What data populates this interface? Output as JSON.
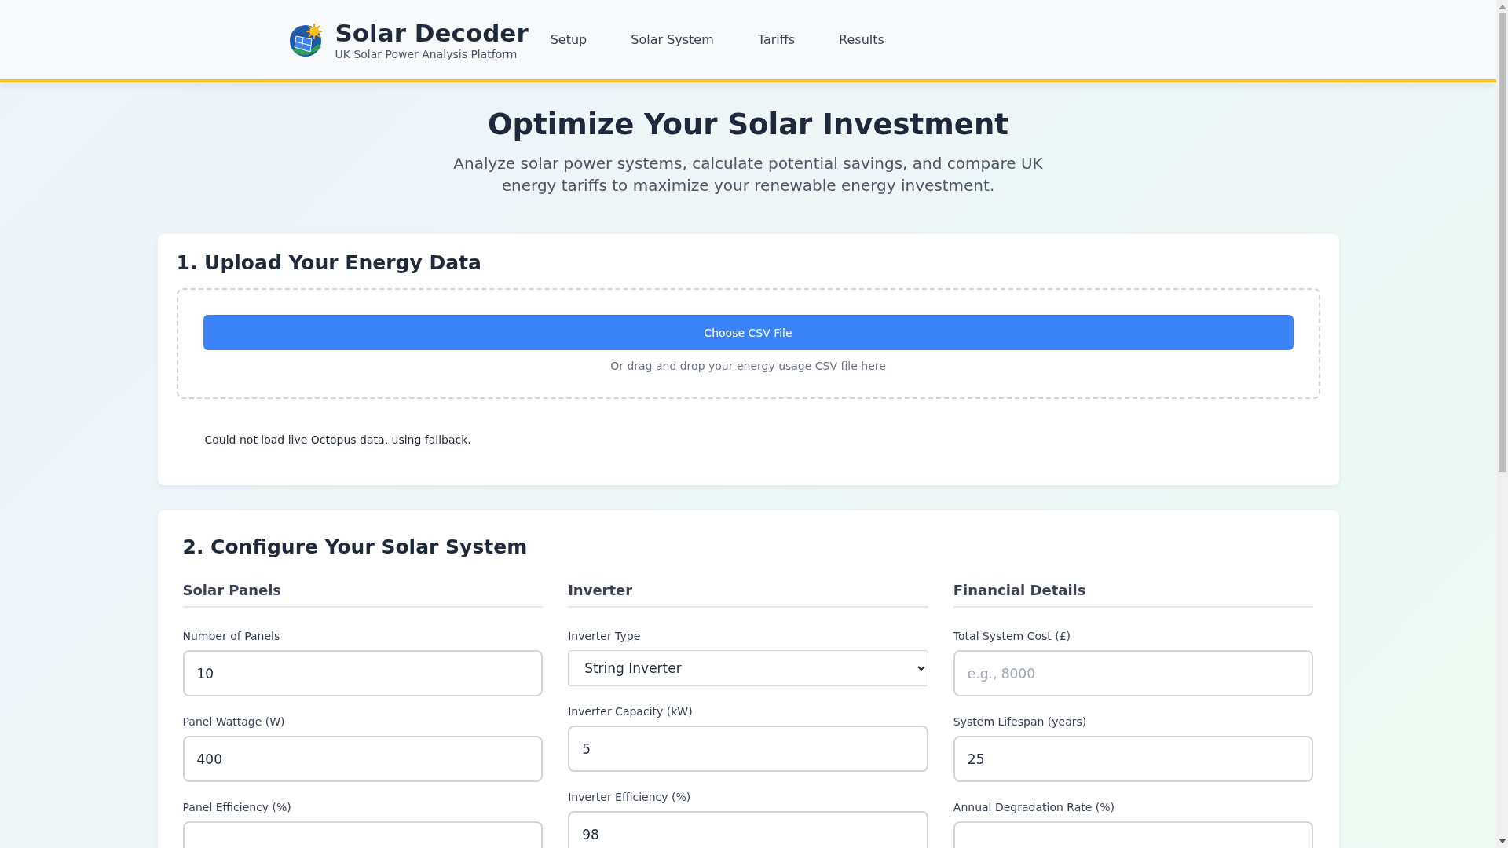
{
  "header": {
    "brand": "Solar Decoder",
    "tagline": "UK Solar Power Analysis Platform",
    "nav": [
      {
        "label": "Setup"
      },
      {
        "label": "Solar System"
      },
      {
        "label": "Tariffs"
      },
      {
        "label": "Results"
      }
    ]
  },
  "hero": {
    "title": "Optimize Your Solar Investment",
    "subtitle": "Analyze solar power systems, calculate potential savings, and compare UK energy tariffs to maximize your renewable energy investment."
  },
  "upload": {
    "title": "1. Upload Your Energy Data",
    "button": "Choose CSV File",
    "hint": "Or drag and drop your energy usage CSV file here",
    "status": "Could not load live Octopus data, using fallback."
  },
  "configure": {
    "title": "2. Configure Your Solar System",
    "columns": [
      {
        "heading": "Solar Panels",
        "fields": [
          {
            "kind": "input",
            "label": "Number of Panels",
            "value": "10"
          },
          {
            "kind": "input",
            "label": "Panel Wattage (W)",
            "value": "400"
          },
          {
            "kind": "input",
            "label": "Panel Efficiency (%)"
          }
        ]
      },
      {
        "heading": "Inverter",
        "fields": [
          {
            "kind": "select",
            "label": "Inverter Type",
            "value": "String Inverter"
          },
          {
            "kind": "input",
            "label": "Inverter Capacity (kW)",
            "value": "5"
          },
          {
            "kind": "input",
            "label": "Inverter Efficiency (%)",
            "value": "98"
          }
        ]
      },
      {
        "heading": "Financial Details",
        "fields": [
          {
            "kind": "input",
            "label": "Total System Cost (£)",
            "placeholder": "e.g., 8000"
          },
          {
            "kind": "input",
            "label": "System Lifespan (years)",
            "value": "25"
          },
          {
            "kind": "input",
            "label": "Annual Degradation Rate (%)"
          }
        ]
      }
    ]
  }
}
